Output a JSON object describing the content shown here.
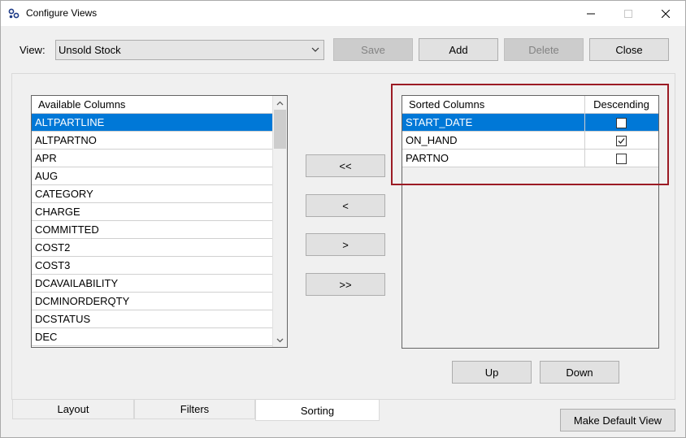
{
  "window": {
    "title": "Configure Views"
  },
  "icons": {
    "app": "app-icon",
    "minimize": "minimize-icon",
    "maximize": "maximize-icon",
    "close": "close-icon",
    "dropdown": "chevron-down-icon",
    "scroll_up": "chevron-up-icon",
    "scroll_down": "chevron-down-icon",
    "checkbox": "checkbox-icon"
  },
  "toolbar": {
    "view_label": "View:",
    "view_value": "Unsold Stock",
    "save_label": "Save",
    "add_label": "Add",
    "delete_label": "Delete",
    "close_label": "Close"
  },
  "available": {
    "header": "Available Columns",
    "items": [
      {
        "label": "ALTPARTLINE",
        "selected": true
      },
      {
        "label": "ALTPARTNO",
        "selected": false
      },
      {
        "label": "APR",
        "selected": false
      },
      {
        "label": "AUG",
        "selected": false
      },
      {
        "label": "CATEGORY",
        "selected": false
      },
      {
        "label": "CHARGE",
        "selected": false
      },
      {
        "label": "COMMITTED",
        "selected": false
      },
      {
        "label": "COST2",
        "selected": false
      },
      {
        "label": "COST3",
        "selected": false
      },
      {
        "label": "DCAVAILABILITY",
        "selected": false
      },
      {
        "label": "DCMINORDERQTY",
        "selected": false
      },
      {
        "label": "DCSTATUS",
        "selected": false
      },
      {
        "label": "DEC",
        "selected": false
      }
    ]
  },
  "transfer": {
    "all_left_label": "<<",
    "left_label": "<",
    "right_label": ">",
    "all_right_label": ">>"
  },
  "sorted": {
    "header_col": "Sorted Columns",
    "header_desc": "Descending",
    "rows": [
      {
        "label": "START_DATE",
        "descending": false,
        "selected": true
      },
      {
        "label": "ON_HAND",
        "descending": true,
        "selected": false
      },
      {
        "label": "PARTNO",
        "descending": false,
        "selected": false
      }
    ]
  },
  "order": {
    "up_label": "Up",
    "down_label": "Down"
  },
  "tabs": [
    {
      "label": "Layout",
      "active": false
    },
    {
      "label": "Filters",
      "active": false
    },
    {
      "label": "Sorting",
      "active": true
    }
  ],
  "footer": {
    "default_view_label": "Make Default View"
  },
  "colors": {
    "selection": "#0078d7",
    "highlight_border": "#9b1b24"
  }
}
